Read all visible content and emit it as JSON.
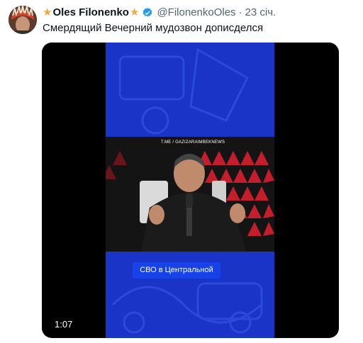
{
  "tweet": {
    "display_name": "Oles Filonenko",
    "name_prefix_icon": "star-icon",
    "name_suffix_icon": "star-icon",
    "verified_icon": "verified-badge-icon",
    "handle": "@FilonenkoOles",
    "separator": "·",
    "time": "23 січ.",
    "text": "Смердящий Вечерний мудозвон дописделся"
  },
  "media": {
    "video_caption": "СВО в Центральной",
    "watermark": "T.ME / GAZIZARAIMBEKNEWS",
    "duration": "1:07"
  },
  "colors": {
    "text": "#0f1419",
    "secondary": "#536471",
    "star": "#f2a93b",
    "verified": "#1d9bf0",
    "video_blue": "#1b34c8",
    "caption_blue": "#1742e8"
  }
}
